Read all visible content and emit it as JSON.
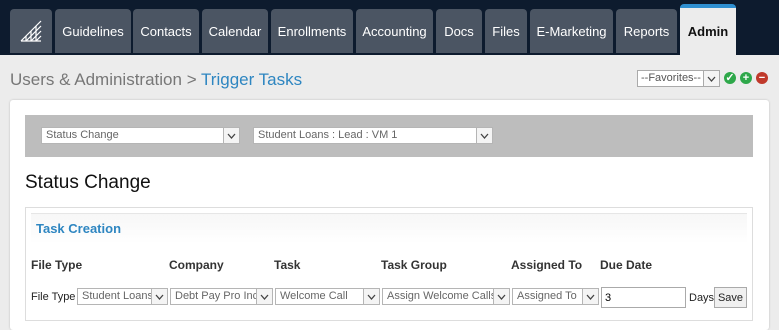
{
  "nav": {
    "tabs": [
      "Guidelines",
      "Contacts",
      "Calendar",
      "Enrollments",
      "Accounting",
      "Docs",
      "Files",
      "E-Marketing",
      "Reports",
      "Admin"
    ],
    "active": "Admin"
  },
  "breadcrumb": {
    "parent": "Users & Administration",
    "separator": ">",
    "current": "Trigger Tasks"
  },
  "favorites": {
    "value": "--Favorites--"
  },
  "filters": {
    "type": "Status Change",
    "status": "Student Loans : Lead : VM 1"
  },
  "page_title": "Status Change",
  "section": {
    "title": "Task Creation",
    "columns": [
      "File Type",
      "Company",
      "Task",
      "Task Group",
      "Assigned To",
      "Due Date"
    ],
    "row": {
      "row_label": "File Type",
      "file_type": "Student Loans",
      "company": "Debt Pay Pro Inc.",
      "task": "Welcome Call",
      "task_group": "Assign Welcome Calls",
      "assigned_to": "Assigned To",
      "due_value": "3",
      "due_unit": "Days",
      "save_label": "Save"
    }
  },
  "colors": {
    "accent": "#2e86c1",
    "nav_bg": "#0d1b2e",
    "tab_bg": "#4b5563",
    "ok": "#2ea84a",
    "remove": "#c0392b"
  }
}
